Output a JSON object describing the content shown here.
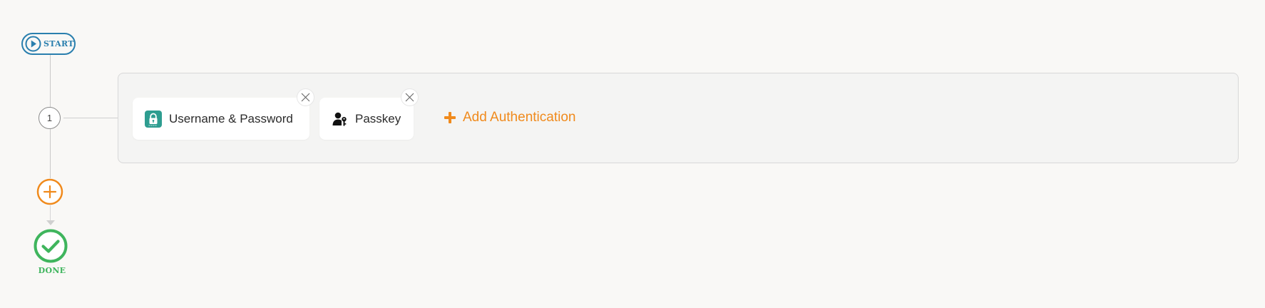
{
  "flow": {
    "start_label": "START",
    "done_label": "DONE",
    "steps": [
      {
        "number": "1",
        "methods": [
          {
            "label": "Username & Password",
            "icon": "lock-icon",
            "remove_icon": "close-icon"
          },
          {
            "label": "Passkey",
            "icon": "user-key-icon",
            "remove_icon": "close-icon"
          }
        ],
        "add_label": "Add Authentication"
      }
    ]
  },
  "colors": {
    "start_accent": "#2a7fae",
    "add_accent": "#f08a1c",
    "done_accent": "#3fb55d",
    "lock_icon_bg": "#2e9d90"
  }
}
